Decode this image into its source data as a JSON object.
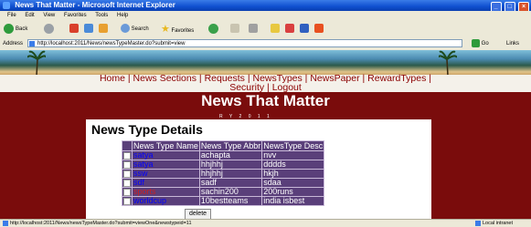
{
  "window": {
    "title": "News That Matter - Microsoft Internet Explorer"
  },
  "menu": [
    "File",
    "Edit",
    "View",
    "Favorites",
    "Tools",
    "Help"
  ],
  "toolbar": {
    "back_label": "Back",
    "search_label": "Search",
    "favorites_label": "Favorites"
  },
  "address": {
    "label": "Address",
    "url": "http://localhost:2011/News/newsTypeMaster.do?submit=view",
    "go_label": "Go",
    "links_label": "Links"
  },
  "nav": {
    "home": "Home",
    "sections": "News Sections",
    "requests": "Requests",
    "types": "NewsTypes",
    "paper": "NewsPaper",
    "reward": "RewardTypes",
    "security": "Security",
    "logout": "Logout"
  },
  "site_title": "News That Matter",
  "deco_text": "R Y 2 0 1 1",
  "panel_title": "News Type Details",
  "table": {
    "headers": [
      "News Type Name",
      "News Type Abbr",
      "NewsType Desc"
    ],
    "rows": [
      {
        "name": "satya",
        "abbr": "achapta",
        "desc": "nvv",
        "color": "blue"
      },
      {
        "name": "satya",
        "abbr": "hhjhhj",
        "desc": "dddds",
        "color": "blue"
      },
      {
        "name": "ssw",
        "abbr": "hhjhhj",
        "desc": "hkjh",
        "color": "blue"
      },
      {
        "name": "sdf",
        "abbr": "sadf",
        "desc": "sdaa",
        "color": "blue"
      },
      {
        "name": "sports",
        "abbr": "sachin200",
        "desc": "200runs",
        "color": "red"
      },
      {
        "name": "worldcup",
        "abbr": "10bestteams",
        "desc": "india isbest",
        "color": "blue"
      }
    ]
  },
  "delete_label": "delete",
  "status": {
    "url": "http://localhost:2011/News/newsTypeMaster.do?submit=viewOne&newstypeid=11",
    "zone": "Local intranet"
  },
  "colors": {
    "page_bg": "#7a0c0c",
    "nav_text": "#8b0000",
    "table_bg": "#5a3f7a",
    "link": "#0000ff",
    "sports": "#cc2020"
  }
}
